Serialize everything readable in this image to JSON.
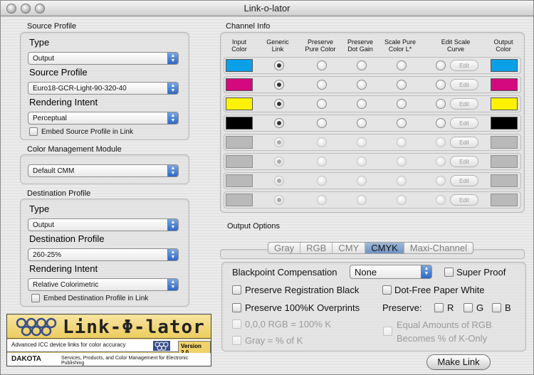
{
  "window": {
    "title": "Link-o-lator"
  },
  "source_profile": {
    "group_title": "Source Profile",
    "type_label": "Type",
    "type_value": "Output",
    "profile_label": "Source Profile",
    "profile_value": "Euro18-GCR-Light-90-320-40",
    "intent_label": "Rendering Intent",
    "intent_value": "Perceptual",
    "embed_label": "Embed Source Profile in Link"
  },
  "cmm": {
    "group_title": "Color Management Module",
    "value": "Default CMM"
  },
  "destination_profile": {
    "group_title": "Destination Profile",
    "type_label": "Type",
    "type_value": "Output",
    "profile_label": "Destination Profile",
    "profile_value": "260-25%",
    "intent_label": "Rendering Intent",
    "intent_value": "Relative Colorimetric",
    "embed_label": "Embed Destination Profile in Link"
  },
  "channel_info": {
    "group_title": "Channel Info",
    "headers": [
      "Input Color",
      "Generic Link",
      "Preserve Pure Color",
      "Preserve Dot Gain",
      "Scale Pure Color L*",
      "Edit Scale Curve",
      "Output Color"
    ],
    "edit_label": "Edit",
    "rows": [
      {
        "input": "#0aa0e8",
        "output": "#0aa0e8",
        "active": true
      },
      {
        "input": "#d4097f",
        "output": "#d4097f",
        "active": true
      },
      {
        "input": "#fff200",
        "output": "#fff200",
        "active": true
      },
      {
        "input": "#000000",
        "output": "#000000",
        "active": true
      },
      {
        "input": "#b9b9b9",
        "output": "#b9b9b9",
        "active": false
      },
      {
        "input": "#b9b9b9",
        "output": "#b9b9b9",
        "active": false
      },
      {
        "input": "#b9b9b9",
        "output": "#b9b9b9",
        "active": false
      },
      {
        "input": "#b9b9b9",
        "output": "#b9b9b9",
        "active": false
      }
    ]
  },
  "output_options": {
    "group_title": "Output Options",
    "tabs": [
      "Gray",
      "RGB",
      "CMY",
      "CMYK",
      "Maxi-Channel"
    ],
    "active_tab": "CMYK",
    "blackpoint_label": "Blackpoint Compensation",
    "blackpoint_value": "None",
    "super_proof": "Super Proof",
    "preserve_reg_black": "Preserve Registration Black",
    "dot_free": "Dot-Free Paper White",
    "preserve_100k": "Preserve 100%K Overprints",
    "preserve_label": "Preserve:",
    "r": "R",
    "g": "G",
    "b": "B",
    "rgb_100k": "0,0,0 RGB = 100% K",
    "equal_amounts": "Equal Amounts of RGB",
    "becomes_k": "Becomes % of K-Only",
    "gray_pct": "Gray = % of K"
  },
  "make_link": "Make Link",
  "logo": {
    "word": "Link-Φ-lator",
    "tagline": "Advanced ICC device links for color accuracy",
    "version": "Version 2.0",
    "brand": "DAKOTA",
    "services": "Services, Products, and Color Management for Electronic Publishing"
  }
}
